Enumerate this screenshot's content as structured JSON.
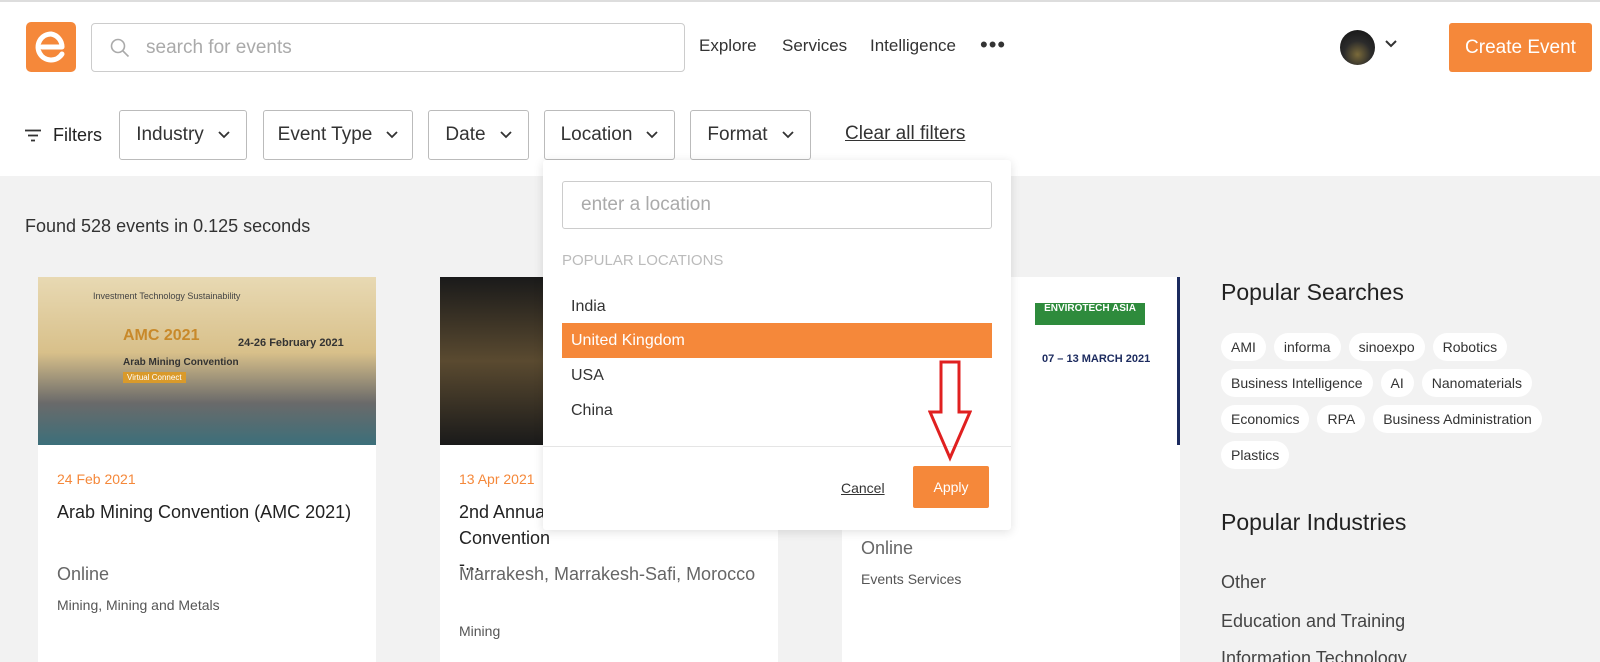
{
  "header": {
    "search_placeholder": "search for events",
    "nav": [
      "Explore",
      "Services",
      "Intelligence"
    ],
    "more_label": "•••",
    "create_label": "Create Event"
  },
  "filters": {
    "label": "Filters",
    "buttons": [
      "Industry",
      "Event Type",
      "Date",
      "Location",
      "Format"
    ],
    "clear_label": "Clear all filters"
  },
  "results": {
    "found_text": "Found 528 events in 0.125 seconds"
  },
  "cards": [
    {
      "date": "24 Feb 2021",
      "title": "Arab Mining Convention (AMC 2021)",
      "location": "Online",
      "category": "Mining, Mining and Metals",
      "image_text": {
        "top": "Investment   Technology   Sustainability",
        "name": "AMC 2021",
        "dates": "24-26 February 2021",
        "subtitle": "Arab Mining Convention",
        "tag": "Virtual Connect"
      }
    },
    {
      "date": "13 Apr 2021",
      "title": "2nd Annua Convention -...",
      "location": "Marrakesh, Marrakesh-Safi, Morocco",
      "category": "Mining"
    },
    {
      "date": "",
      "title": "",
      "location": "Online",
      "category": "Events Services",
      "image_text": {
        "brand": "ENVIROTECH ASIA",
        "dates": "07 – 13 MARCH 2021"
      }
    }
  ],
  "sidebar": {
    "popular_searches_title": "Popular Searches",
    "tags": [
      "AMI",
      "informa",
      "sinoexpo",
      "Robotics",
      "Business Intelligence",
      "AI",
      "Nanomaterials",
      "Economics",
      "RPA",
      "Business Administration",
      "Plastics"
    ],
    "popular_industries_title": "Popular Industries",
    "industries": [
      "Other",
      "Education and Training",
      "Information Technology"
    ]
  },
  "location_dropdown": {
    "placeholder": "enter a location",
    "heading": "POPULAR LOCATIONS",
    "items": [
      "India",
      "United Kingdom",
      "USA",
      "China"
    ],
    "selected": "United Kingdom",
    "cancel_label": "Cancel",
    "apply_label": "Apply"
  },
  "colors": {
    "accent": "#f5883a",
    "annotation_arrow": "#e02020"
  }
}
